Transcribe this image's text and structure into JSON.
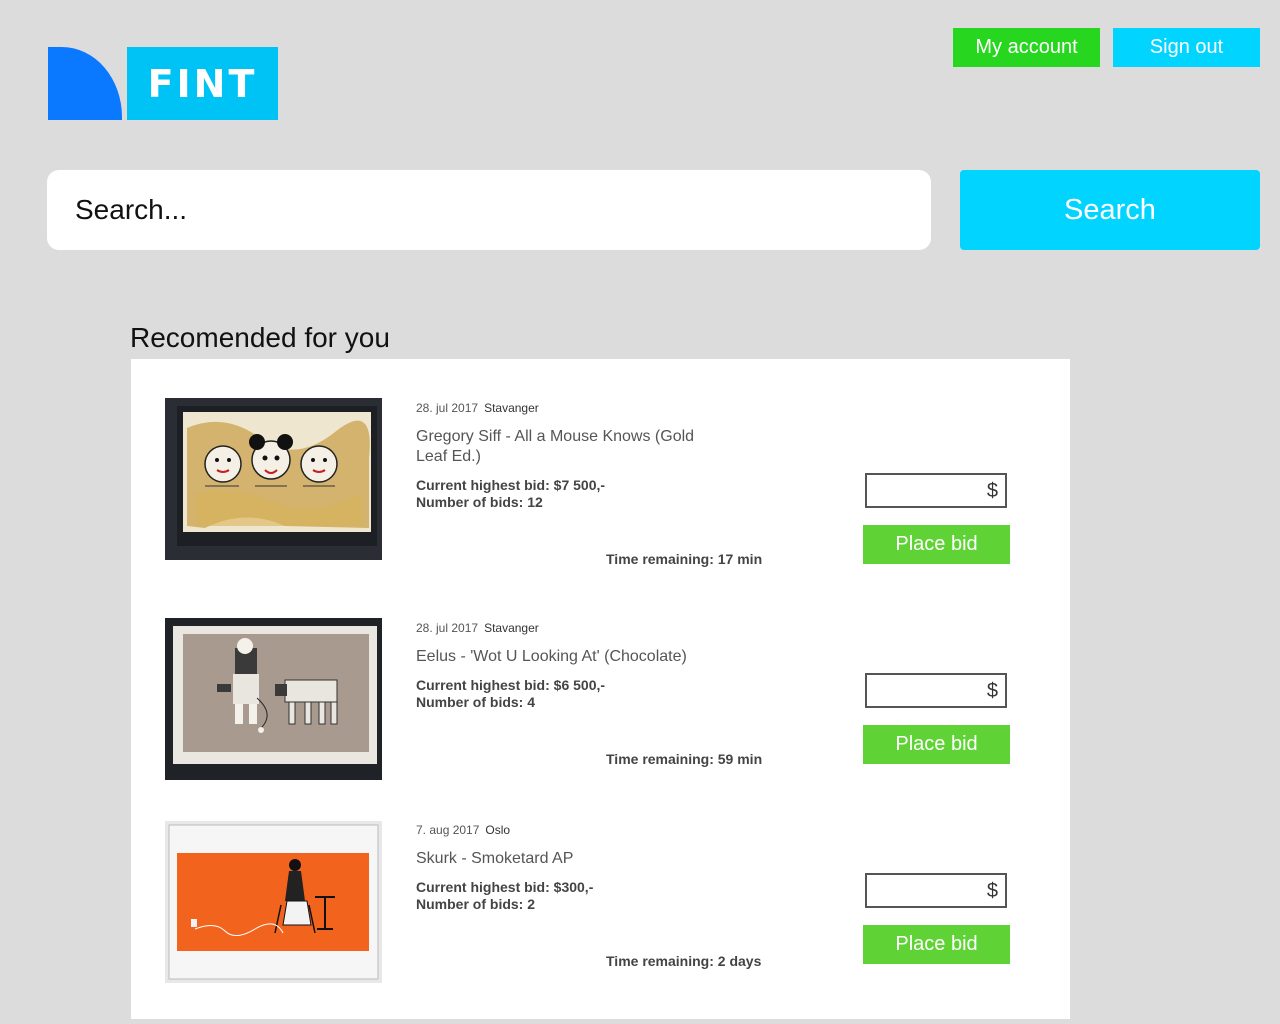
{
  "brand": {
    "logo_text": "FINT",
    "shape_color": "#0a78ff",
    "box_color": "#00c3f5"
  },
  "header": {
    "account_label": "My account",
    "signout_label": "Sign out",
    "account_color": "#27d61e",
    "signout_color": "#00d4ff"
  },
  "search": {
    "placeholder": "Search...",
    "button_label": "Search"
  },
  "section": {
    "title": "Recomended for you"
  },
  "items": [
    {
      "date": "28. jul 2017",
      "location": "Stavanger",
      "title": "Gregory Siff - All a Mouse Knows (Gold Leaf Ed.)",
      "highest_bid": "Current highest bid: $7 500,-",
      "num_bids": "Number of bids: 12",
      "time_remaining": "Time remaining: 17 min",
      "currency": "$",
      "bid_button": "Place bid",
      "image": "artwork-gold-leaf-faces"
    },
    {
      "date": "28. jul 2017",
      "location": "Stavanger",
      "title": "Eelus - 'Wot U Looking At' (Chocolate)",
      "highest_bid": "Current highest bid: $6 500,-",
      "num_bids": "Number of bids: 4",
      "time_remaining": "Time remaining: 59 min",
      "currency": "$",
      "bid_button": "Place bid",
      "image": "artwork-child-with-walker"
    },
    {
      "date": "7. aug 2017",
      "location": "Oslo",
      "title": "Skurk - Smoketard AP",
      "highest_bid": "Current highest bid: $300,-",
      "num_bids": "Number of bids: 2",
      "time_remaining": "Time remaining: 2 days",
      "currency": "$",
      "bid_button": "Place bid",
      "image": "artwork-orange-smoker"
    }
  ]
}
